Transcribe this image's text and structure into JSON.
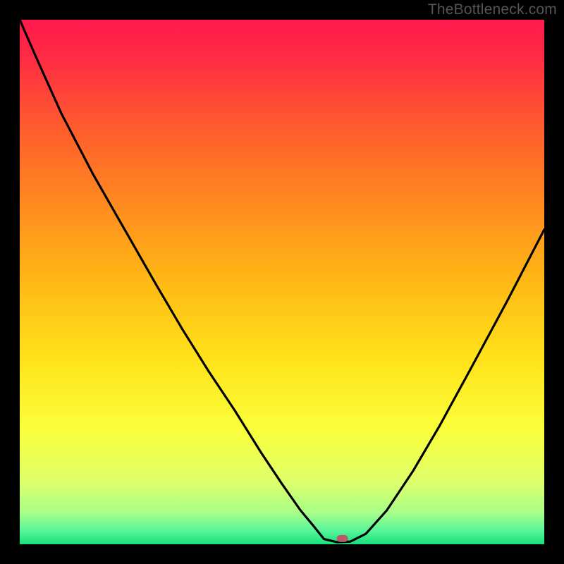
{
  "watermark": "TheBottleneck.com",
  "chart_data": {
    "type": "line",
    "title": "",
    "xlabel": "",
    "ylabel": "",
    "xlim": [
      0,
      100
    ],
    "ylim": [
      0,
      100
    ],
    "gradient_stops": [
      {
        "offset": 0.0,
        "color": "#ff1a4d"
      },
      {
        "offset": 0.07,
        "color": "#ff2a44"
      },
      {
        "offset": 0.2,
        "color": "#ff5a2e"
      },
      {
        "offset": 0.35,
        "color": "#ff8a1f"
      },
      {
        "offset": 0.5,
        "color": "#ffb915"
      },
      {
        "offset": 0.65,
        "color": "#ffe31a"
      },
      {
        "offset": 0.78,
        "color": "#faff3a"
      },
      {
        "offset": 0.88,
        "color": "#deff6a"
      },
      {
        "offset": 0.94,
        "color": "#a8ff8a"
      },
      {
        "offset": 0.975,
        "color": "#55f59a"
      },
      {
        "offset": 1.0,
        "color": "#16e07a"
      }
    ],
    "series": [
      {
        "name": "bottleneck-curve",
        "x": [
          0.0,
          3.5,
          8.0,
          14.0,
          20.0,
          26.0,
          31.0,
          36.0,
          41.0,
          46.0,
          50.0,
          53.5,
          56.0,
          58.0,
          60.5,
          63.0,
          66.0,
          70.0,
          75.0,
          80.0,
          86.0,
          93.0,
          100.0
        ],
        "y": [
          100.0,
          92.0,
          82.0,
          70.5,
          60.0,
          49.5,
          41.0,
          33.0,
          25.5,
          17.5,
          11.5,
          6.5,
          3.5,
          1.0,
          0.4,
          0.5,
          2.0,
          6.5,
          14.0,
          22.5,
          33.5,
          46.5,
          60.0
        ]
      }
    ],
    "marker": {
      "x": 61.5,
      "y": 1.1,
      "color": "#b9596b"
    },
    "optimum_x": 60.0
  }
}
